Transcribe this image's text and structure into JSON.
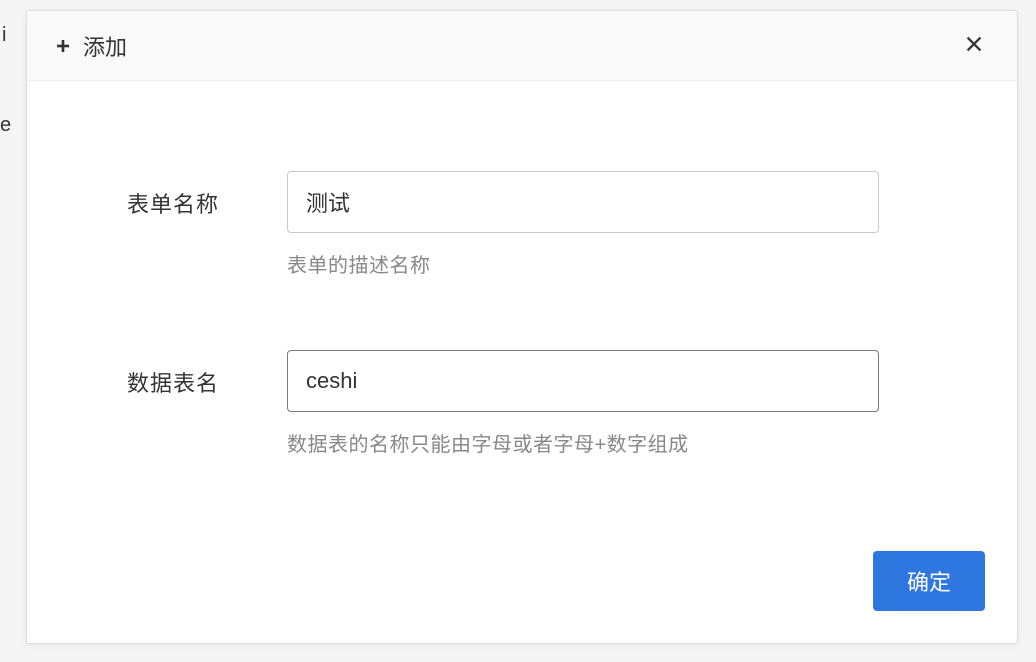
{
  "background": {
    "line1": "i",
    "line2": "e"
  },
  "modal": {
    "header": {
      "title": "添加"
    },
    "form": {
      "form_name": {
        "label": "表单名称",
        "value": "测试",
        "helper": "表单的描述名称"
      },
      "table_name": {
        "label": "数据表名",
        "value": "ceshi",
        "helper": "数据表的名称只能由字母或者字母+数字组成"
      }
    },
    "footer": {
      "confirm_label": "确定"
    }
  }
}
